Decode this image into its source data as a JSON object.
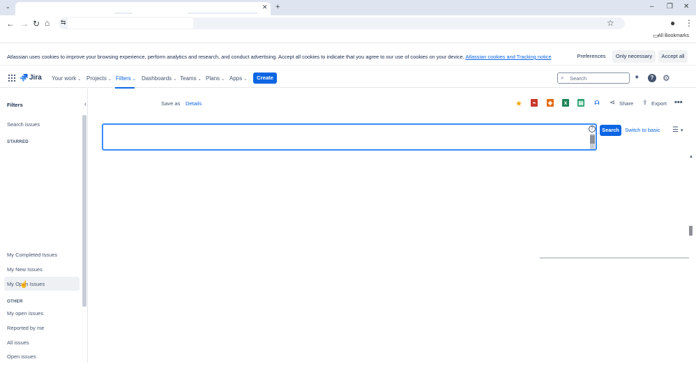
{
  "browser": {
    "bookmarks_label": "All Bookmarks"
  },
  "cookie_banner": {
    "text": "Atlassian uses cookies to improve your browsing experience, perform analytics and research, and conduct advertising. Accept all cookies to indicate that you agree to our use of cookies on your device.",
    "link": "Atlassian cookies and Tracking notice",
    "preferences": "Preferences",
    "only_necessary": "Only necessary",
    "accept_all": "Accept all"
  },
  "topnav": {
    "logo": "Jira",
    "your_work": "Your work",
    "projects": "Projects",
    "filters": "Filters",
    "dashboards": "Dashboards",
    "teams": "Teams",
    "plans": "Plans",
    "apps": "Apps",
    "create": "Create",
    "search_placeholder": "Search"
  },
  "sidebar": {
    "title": "Filters",
    "search_issues": "Search issues",
    "starred_heading": "STARRED",
    "items": [
      "My Completed Issues",
      "My New Issues",
      "My Open Issues"
    ],
    "other_heading": "OTHER",
    "other_items": [
      "My open issues",
      "Reported by me",
      "All issues",
      "Open issues"
    ]
  },
  "main": {
    "save_as": "Save as",
    "details": "Details",
    "share": "Share",
    "export": "Export",
    "search_button": "Search",
    "switch_to_basic": "Switch to basic",
    "jql_value": ""
  },
  "colors": {
    "brand": "#0c66e4",
    "focus": "#388bff"
  }
}
